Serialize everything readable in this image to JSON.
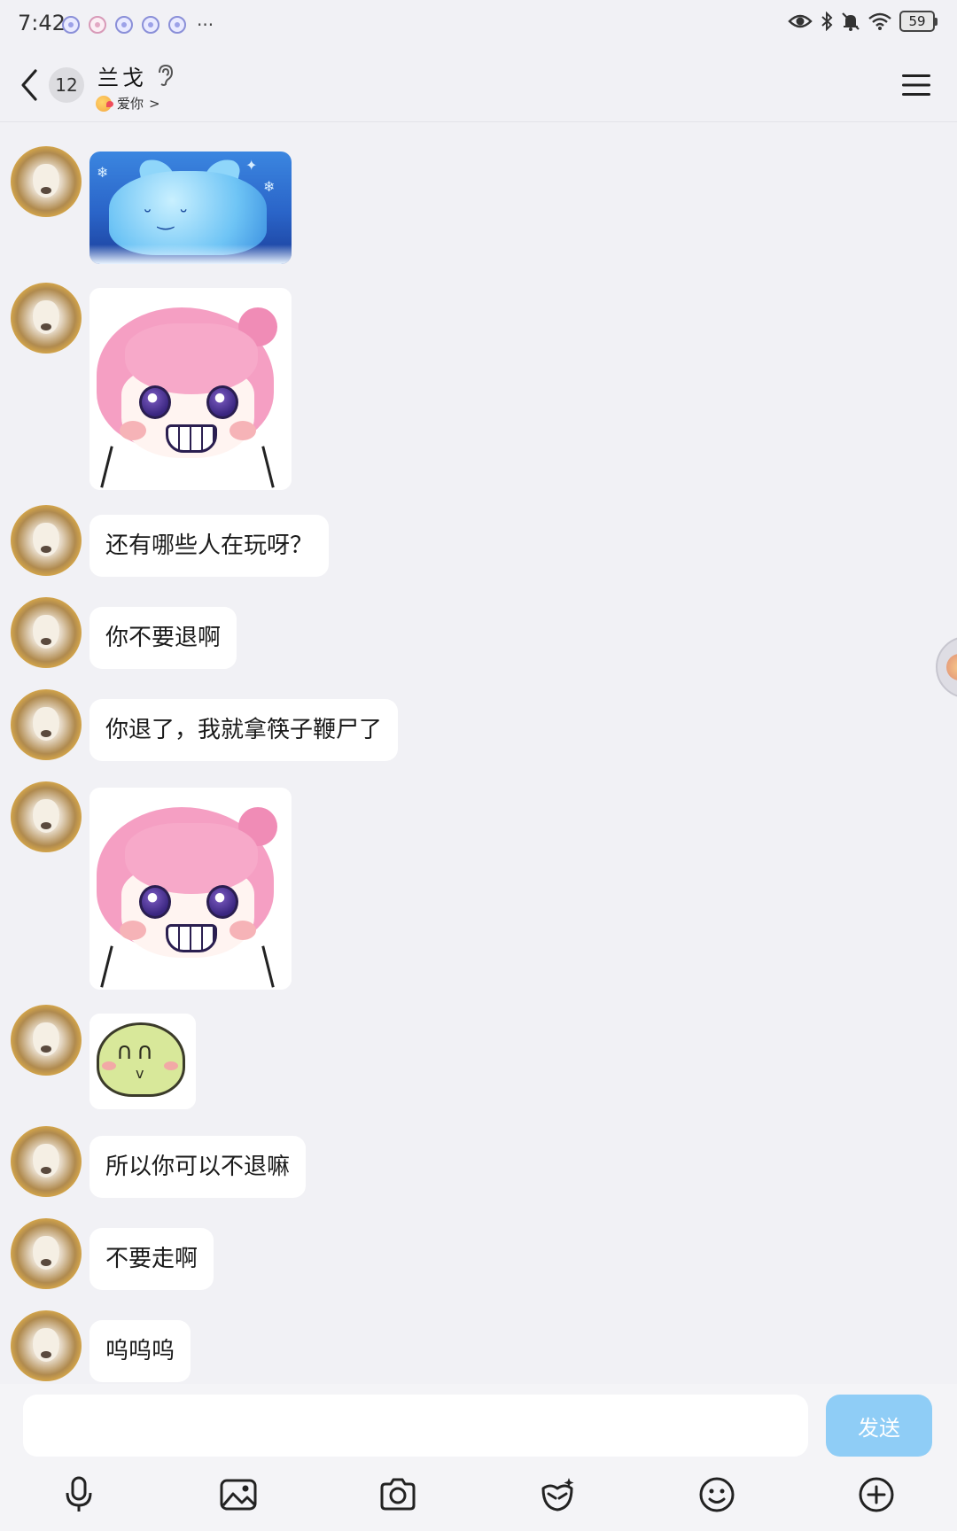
{
  "status_bar": {
    "time": "7:42",
    "notifications_more": "···",
    "battery_level": "59"
  },
  "header": {
    "unread_count": "12",
    "contact_name": "兰戈",
    "contact_status": "爱你",
    "status_chevron": ">"
  },
  "messages": [
    {
      "type": "sticker",
      "sticker": "ice-cat",
      "face": "˘‿˘"
    },
    {
      "type": "sticker",
      "sticker": "pink-hair-girl-grin"
    },
    {
      "type": "text",
      "text": "还有哪些人在玩呀？"
    },
    {
      "type": "text",
      "text": "你不要退啊"
    },
    {
      "type": "text",
      "text": "你退了，我就拿筷子鞭尸了"
    },
    {
      "type": "sticker",
      "sticker": "pink-hair-girl-grin"
    },
    {
      "type": "sticker",
      "sticker": "green-blob-smile",
      "eyes": "∩∩",
      "mouth": "v"
    },
    {
      "type": "text",
      "text": "所以你可以不退嘛"
    },
    {
      "type": "text",
      "text": "不要走啊"
    },
    {
      "type": "text",
      "text": "呜呜呜"
    }
  ],
  "composer": {
    "input_value": "",
    "input_placeholder": "",
    "send_label": "发送"
  },
  "toolbar": [
    "microphone-icon",
    "image-icon",
    "camera-icon",
    "red-packet-icon",
    "emoji-icon",
    "plus-icon"
  ],
  "colors": {
    "background": "#f1f1f5",
    "bubble": "#ffffff",
    "send_button": "#8fcdf6"
  }
}
